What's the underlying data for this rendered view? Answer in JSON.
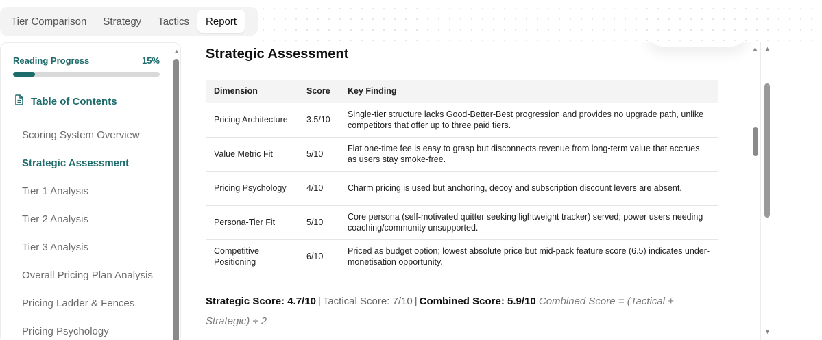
{
  "tabs": [
    {
      "label": "Tier Comparison"
    },
    {
      "label": "Strategy"
    },
    {
      "label": "Tactics"
    },
    {
      "label": "Report"
    }
  ],
  "active_tab": "Report",
  "sidebar": {
    "progress_label": "Reading Progress",
    "progress_value": "15%",
    "progress_fraction": 0.15,
    "toc_title": "Table of Contents",
    "toc_icon": "document-icon",
    "items": [
      {
        "label": "Scoring System Overview"
      },
      {
        "label": "Strategic Assessment"
      },
      {
        "label": "Tier 1 Analysis"
      },
      {
        "label": "Tier 2 Analysis"
      },
      {
        "label": "Tier 3 Analysis"
      },
      {
        "label": "Overall Pricing Plan Analysis"
      },
      {
        "label": "Pricing Ladder & Fences"
      },
      {
        "label": "Pricing Psychology"
      }
    ],
    "active_item": "Strategic Assessment"
  },
  "main": {
    "section_title": "Strategic Assessment",
    "table": {
      "headers": [
        "Dimension",
        "Score",
        "Key Finding"
      ],
      "rows": [
        {
          "dimension": "Pricing Architecture",
          "score": "3.5/10",
          "finding": "Single-tier structure lacks Good-Better-Best progression and provides no upgrade path, unlike competitors that offer up to three paid tiers."
        },
        {
          "dimension": "Value Metric Fit",
          "score": "5/10",
          "finding": "Flat one-time fee is easy to grasp but disconnects revenue from long-term value that accrues as users stay smoke-free."
        },
        {
          "dimension": "Pricing Psychology",
          "score": "4/10",
          "finding": "Charm pricing is used but anchoring, decoy and subscription discount levers are absent."
        },
        {
          "dimension": "Persona-Tier Fit",
          "score": "5/10",
          "finding": "Core persona (self-motivated quitter seeking lightweight tracker) served; power users needing coaching/community unsupported."
        },
        {
          "dimension": "Competitive Positioning",
          "score": "6/10",
          "finding": "Priced as budget option; lowest absolute price but mid-pack feature score (6.5) indicates under-monetisation opportunity."
        }
      ]
    },
    "scores": {
      "strategic": "Strategic Score: 4.7/10",
      "tactical": "Tactical Score: 7/10",
      "combined": "Combined Score: 5.9/10",
      "formula": "Combined Score = (Tactical + Strategic) ÷ 2"
    }
  },
  "colors": {
    "accent": "#1e6b6b",
    "tab_bg": "#f3f3f3",
    "table_header_bg": "#f4f4f4"
  }
}
